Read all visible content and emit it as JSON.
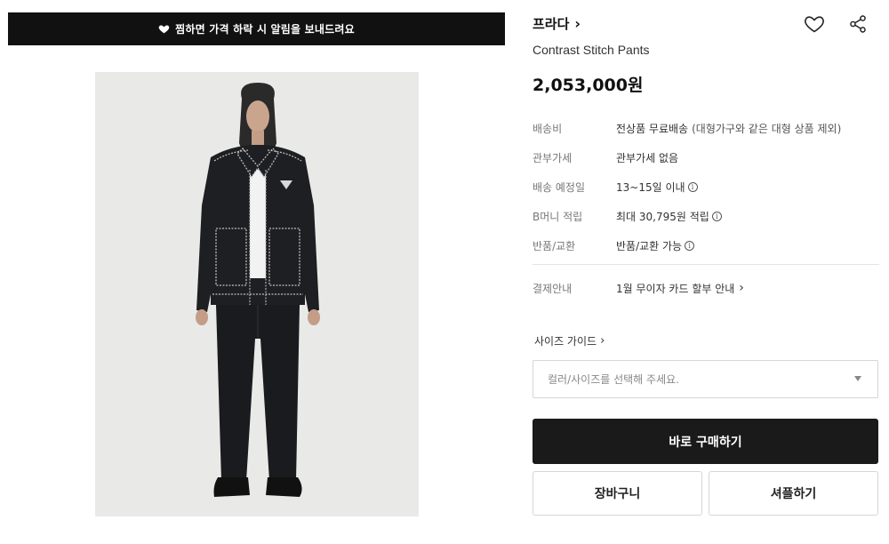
{
  "promo_banner": {
    "icon": "heart-icon",
    "text": "찜하면 가격 하락 시 알림을 보내드려요"
  },
  "product_image": {
    "alt": "product-photo",
    "background": "#e9e9e7"
  },
  "brand": {
    "name": "프라다",
    "chevron": "›"
  },
  "product_name": "Contrast Stitch Pants",
  "price": "2,053,000원",
  "info_rows": [
    {
      "label": "배송비",
      "value": "전상품 무료배송",
      "sub": "(대형가구와 같은 대형 상품 제외)",
      "info_icon": false
    },
    {
      "label": "관부가세",
      "value": "관부가세 없음",
      "sub": "",
      "info_icon": false
    },
    {
      "label": "배송 예정일",
      "value": "13~15일 이내",
      "sub": "",
      "info_icon": true
    },
    {
      "label": "B머니 적립",
      "value": "최대 30,795원 적립",
      "sub": "",
      "info_icon": true
    },
    {
      "label": "반품/교환",
      "value": "반품/교환 가능",
      "sub": "",
      "info_icon": true
    }
  ],
  "payment": {
    "label": "결제안내",
    "value": "1월 무이자 카드 할부 안내",
    "chevron": "›"
  },
  "size_guide": {
    "label": "사이즈 가이드",
    "chevron": "›"
  },
  "option_select": {
    "placeholder": "컬러/사이즈를 선택해 주세요."
  },
  "buttons": {
    "buy_now": "바로 구매하기",
    "cart": "장바구니",
    "shopple": "셔플하기"
  },
  "colors": {
    "banner_bg": "#111111",
    "buy_bg": "#1a1a1a",
    "label_gray": "#777777"
  }
}
